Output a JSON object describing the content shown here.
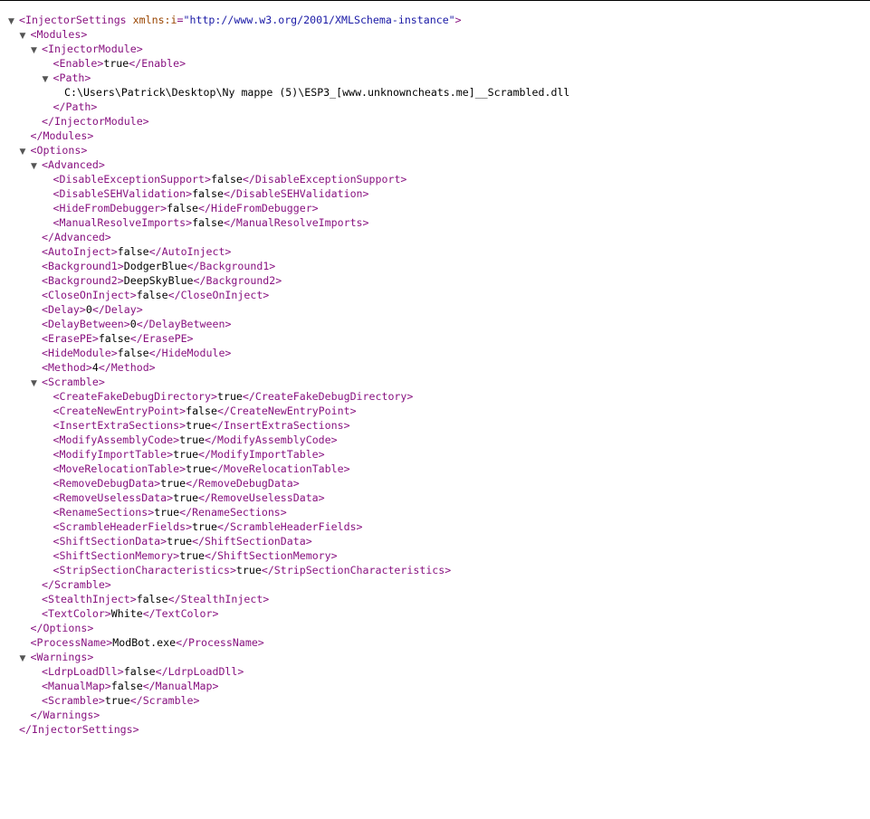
{
  "xml": {
    "root": {
      "tag": "InjectorSettings",
      "attr_name": "xmlns:i",
      "attr_value": "http://www.w3.org/2001/XMLSchema-instance"
    },
    "lines": [
      {
        "depth": 0,
        "kind": "open",
        "tag": "InjectorSettings",
        "attr": true,
        "toggle": true
      },
      {
        "depth": 1,
        "kind": "open",
        "tag": "Modules",
        "toggle": true
      },
      {
        "depth": 2,
        "kind": "open",
        "tag": "InjectorModule",
        "toggle": true
      },
      {
        "depth": 3,
        "kind": "leaf",
        "tag": "Enable",
        "value": "true"
      },
      {
        "depth": 3,
        "kind": "open",
        "tag": "Path",
        "toggle": true
      },
      {
        "depth": 4,
        "kind": "text",
        "value": "C:\\Users\\Patrick\\Desktop\\Ny mappe (5)\\ESP3_[www.unknowncheats.me]__Scrambled.dll"
      },
      {
        "depth": 3,
        "kind": "close",
        "tag": "Path"
      },
      {
        "depth": 2,
        "kind": "close",
        "tag": "InjectorModule"
      },
      {
        "depth": 1,
        "kind": "close",
        "tag": "Modules"
      },
      {
        "depth": 1,
        "kind": "open",
        "tag": "Options",
        "toggle": true
      },
      {
        "depth": 2,
        "kind": "open",
        "tag": "Advanced",
        "toggle": true
      },
      {
        "depth": 3,
        "kind": "leaf",
        "tag": "DisableExceptionSupport",
        "value": "false"
      },
      {
        "depth": 3,
        "kind": "leaf",
        "tag": "DisableSEHValidation",
        "value": "false"
      },
      {
        "depth": 3,
        "kind": "leaf",
        "tag": "HideFromDebugger",
        "value": "false"
      },
      {
        "depth": 3,
        "kind": "leaf",
        "tag": "ManualResolveImports",
        "value": "false"
      },
      {
        "depth": 2,
        "kind": "close",
        "tag": "Advanced"
      },
      {
        "depth": 2,
        "kind": "leaf",
        "tag": "AutoInject",
        "value": "false"
      },
      {
        "depth": 2,
        "kind": "leaf",
        "tag": "Background1",
        "value": "DodgerBlue"
      },
      {
        "depth": 2,
        "kind": "leaf",
        "tag": "Background2",
        "value": "DeepSkyBlue"
      },
      {
        "depth": 2,
        "kind": "leaf",
        "tag": "CloseOnInject",
        "value": "false"
      },
      {
        "depth": 2,
        "kind": "leaf",
        "tag": "Delay",
        "value": "0"
      },
      {
        "depth": 2,
        "kind": "leaf",
        "tag": "DelayBetween",
        "value": "0"
      },
      {
        "depth": 2,
        "kind": "leaf",
        "tag": "ErasePE",
        "value": "false"
      },
      {
        "depth": 2,
        "kind": "leaf",
        "tag": "HideModule",
        "value": "false"
      },
      {
        "depth": 2,
        "kind": "leaf",
        "tag": "Method",
        "value": "4"
      },
      {
        "depth": 2,
        "kind": "open",
        "tag": "Scramble",
        "toggle": true
      },
      {
        "depth": 3,
        "kind": "leaf",
        "tag": "CreateFakeDebugDirectory",
        "value": "true"
      },
      {
        "depth": 3,
        "kind": "leaf",
        "tag": "CreateNewEntryPoint",
        "value": "false"
      },
      {
        "depth": 3,
        "kind": "leaf",
        "tag": "InsertExtraSections",
        "value": "true"
      },
      {
        "depth": 3,
        "kind": "leaf",
        "tag": "ModifyAssemblyCode",
        "value": "true"
      },
      {
        "depth": 3,
        "kind": "leaf",
        "tag": "ModifyImportTable",
        "value": "true"
      },
      {
        "depth": 3,
        "kind": "leaf",
        "tag": "MoveRelocationTable",
        "value": "true"
      },
      {
        "depth": 3,
        "kind": "leaf",
        "tag": "RemoveDebugData",
        "value": "true"
      },
      {
        "depth": 3,
        "kind": "leaf",
        "tag": "RemoveUselessData",
        "value": "true"
      },
      {
        "depth": 3,
        "kind": "leaf",
        "tag": "RenameSections",
        "value": "true"
      },
      {
        "depth": 3,
        "kind": "leaf",
        "tag": "ScrambleHeaderFields",
        "value": "true"
      },
      {
        "depth": 3,
        "kind": "leaf",
        "tag": "ShiftSectionData",
        "value": "true"
      },
      {
        "depth": 3,
        "kind": "leaf",
        "tag": "ShiftSectionMemory",
        "value": "true"
      },
      {
        "depth": 3,
        "kind": "leaf",
        "tag": "StripSectionCharacteristics",
        "value": "true"
      },
      {
        "depth": 2,
        "kind": "close",
        "tag": "Scramble"
      },
      {
        "depth": 2,
        "kind": "leaf",
        "tag": "StealthInject",
        "value": "false"
      },
      {
        "depth": 2,
        "kind": "leaf",
        "tag": "TextColor",
        "value": "White"
      },
      {
        "depth": 1,
        "kind": "close",
        "tag": "Options"
      },
      {
        "depth": 1,
        "kind": "leaf",
        "tag": "ProcessName",
        "value": "ModBot.exe"
      },
      {
        "depth": 1,
        "kind": "open",
        "tag": "Warnings",
        "toggle": true
      },
      {
        "depth": 2,
        "kind": "leaf",
        "tag": "LdrpLoadDll",
        "value": "false"
      },
      {
        "depth": 2,
        "kind": "leaf",
        "tag": "ManualMap",
        "value": "false"
      },
      {
        "depth": 2,
        "kind": "leaf",
        "tag": "Scramble",
        "value": "true"
      },
      {
        "depth": 1,
        "kind": "close",
        "tag": "Warnings"
      },
      {
        "depth": 0,
        "kind": "close",
        "tag": "InjectorSettings"
      }
    ]
  },
  "colors": {
    "tag": "#881280",
    "attribute_name": "#994500",
    "attribute_value": "#1a1aa6",
    "text": "#000000",
    "toggle": "#555555"
  },
  "icons": {
    "expanded_toggle": "triangle-down-icon",
    "glyph": "▼"
  }
}
